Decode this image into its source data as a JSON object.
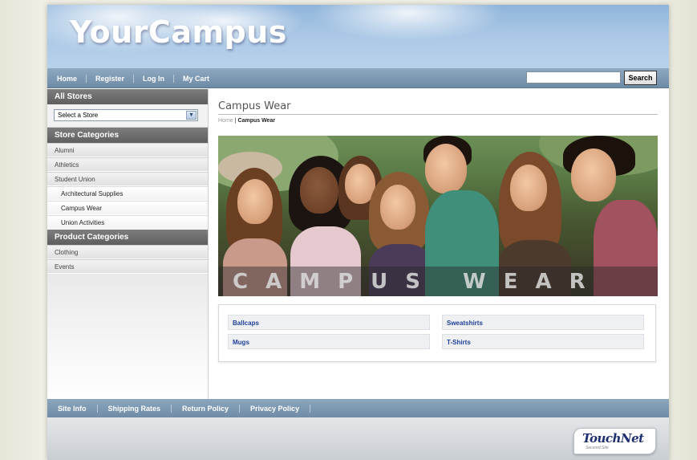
{
  "brand": {
    "logo_text": "YourCampus"
  },
  "topnav": {
    "links": [
      "Home",
      "Register",
      "Log In",
      "My Cart"
    ],
    "search_value": "",
    "search_button": "Search"
  },
  "sidebar": {
    "all_stores_heading": "All Stores",
    "store_select_value": "Select a Store",
    "store_categories_heading": "Store Categories",
    "store_categories": [
      {
        "label": "Alumni",
        "level": 1
      },
      {
        "label": "Athletics",
        "level": 1
      },
      {
        "label": "Student Union",
        "level": 1
      },
      {
        "label": "Architectural Supplies",
        "level": 2
      },
      {
        "label": "Campus Wear",
        "level": 2
      },
      {
        "label": "Union Activities",
        "level": 2
      }
    ],
    "product_categories_heading": "Product Categories",
    "product_categories": [
      "Clothing",
      "Events"
    ]
  },
  "main": {
    "title": "Campus Wear",
    "breadcrumb": {
      "home": "Home",
      "separator": "|",
      "current": "Campus Wear"
    },
    "hero_text": "CAMPUS WEAR",
    "categories": [
      "Ballcaps",
      "Sweatshirts",
      "Mugs",
      "T-Shirts"
    ]
  },
  "footer": {
    "links": [
      "Site Info",
      "Shipping Rates",
      "Return Policy",
      "Privacy Policy"
    ],
    "badge_text": "TouchNet",
    "badge_subtext": "Secured Site"
  },
  "colors": {
    "nav_bar": "#7f9bb4",
    "link_blue": "#1f3f9a",
    "banner_sky": "#a9c7e5",
    "sidebar_heading": "#6d6d6d"
  }
}
